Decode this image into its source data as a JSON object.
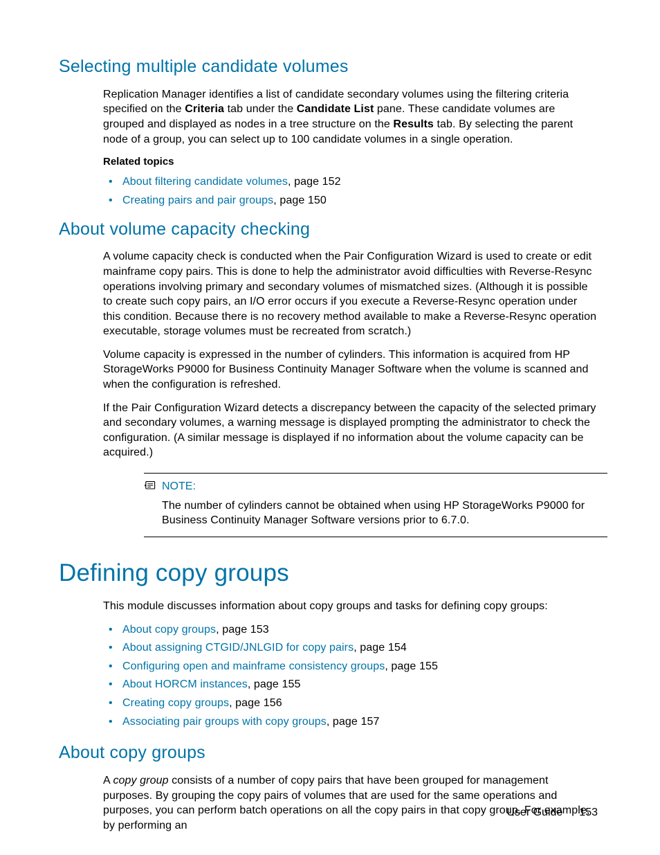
{
  "section1": {
    "heading": "Selecting multiple candidate volumes",
    "para1_a": "Replication Manager identifies a list of candidate secondary volumes using the filtering criteria specified on the ",
    "para1_b": "Criteria",
    "para1_c": " tab under the ",
    "para1_d": "Candidate List",
    "para1_e": " pane. These candidate volumes are grouped and displayed as nodes in a tree structure on the ",
    "para1_f": "Results",
    "para1_g": " tab.  By selecting the parent node of a group, you can select up to 100 candidate volumes in a single operation.",
    "related_label": "Related topics",
    "topics": [
      {
        "link": "About filtering candidate volumes",
        "suffix": ", page 152"
      },
      {
        "link": "Creating pairs and pair groups",
        "suffix": ", page 150"
      }
    ]
  },
  "section2": {
    "heading": "About volume capacity checking",
    "para1": "A volume capacity check is conducted when the Pair Configuration Wizard is used to create or edit mainframe copy pairs. This is done to help the administrator avoid difficulties with Reverse-Resync operations involving primary and secondary volumes of mismatched sizes. (Although it is possible to create such copy pairs, an I/O error occurs if you execute a Reverse-Resync operation under this condition. Because there is no recovery method available to make a Reverse-Resync operation executable, storage volumes must be recreated from scratch.)",
    "para2": "Volume capacity is expressed in the number of cylinders. This information is acquired from HP StorageWorks P9000 for Business Continuity Manager Software when the volume is scanned and when the configuration is refreshed.",
    "para3": "If the Pair Configuration Wizard detects a discrepancy between the capacity of the selected primary and secondary volumes, a warning message is displayed prompting the administrator to check the configuration. (A similar message is displayed if no information about the volume capacity can be acquired.)",
    "note_label": "NOTE:",
    "note_body": "The number of cylinders cannot be obtained when using HP StorageWorks P9000 for Business Continuity Manager Software versions prior to 6.7.0."
  },
  "section3": {
    "heading": "Defining copy groups",
    "intro": "This module discusses information about copy groups and tasks for defining copy groups:",
    "topics": [
      {
        "link": "About copy groups",
        "suffix": ", page 153"
      },
      {
        "link": "About assigning CTGID/JNLGID for copy pairs",
        "suffix": ", page 154"
      },
      {
        "link": "Configuring open and mainframe consistency groups",
        "suffix": ", page 155"
      },
      {
        "link": "About HORCM instances",
        "suffix": ", page 155"
      },
      {
        "link": "Creating copy groups",
        "suffix": ", page 156"
      },
      {
        "link": "Associating pair groups with copy groups",
        "suffix": ", page 157"
      }
    ]
  },
  "section4": {
    "heading": "About copy groups",
    "para1_a": "A ",
    "para1_b": "copy group",
    "para1_c": " consists of a number of copy pairs that have been grouped for management purposes. By grouping the copy pairs of volumes that are used for the same operations and purposes, you can perform batch operations on all the copy pairs in that copy group. For example, by performing an"
  },
  "footer": {
    "doc": "User Guide",
    "page": "153"
  }
}
